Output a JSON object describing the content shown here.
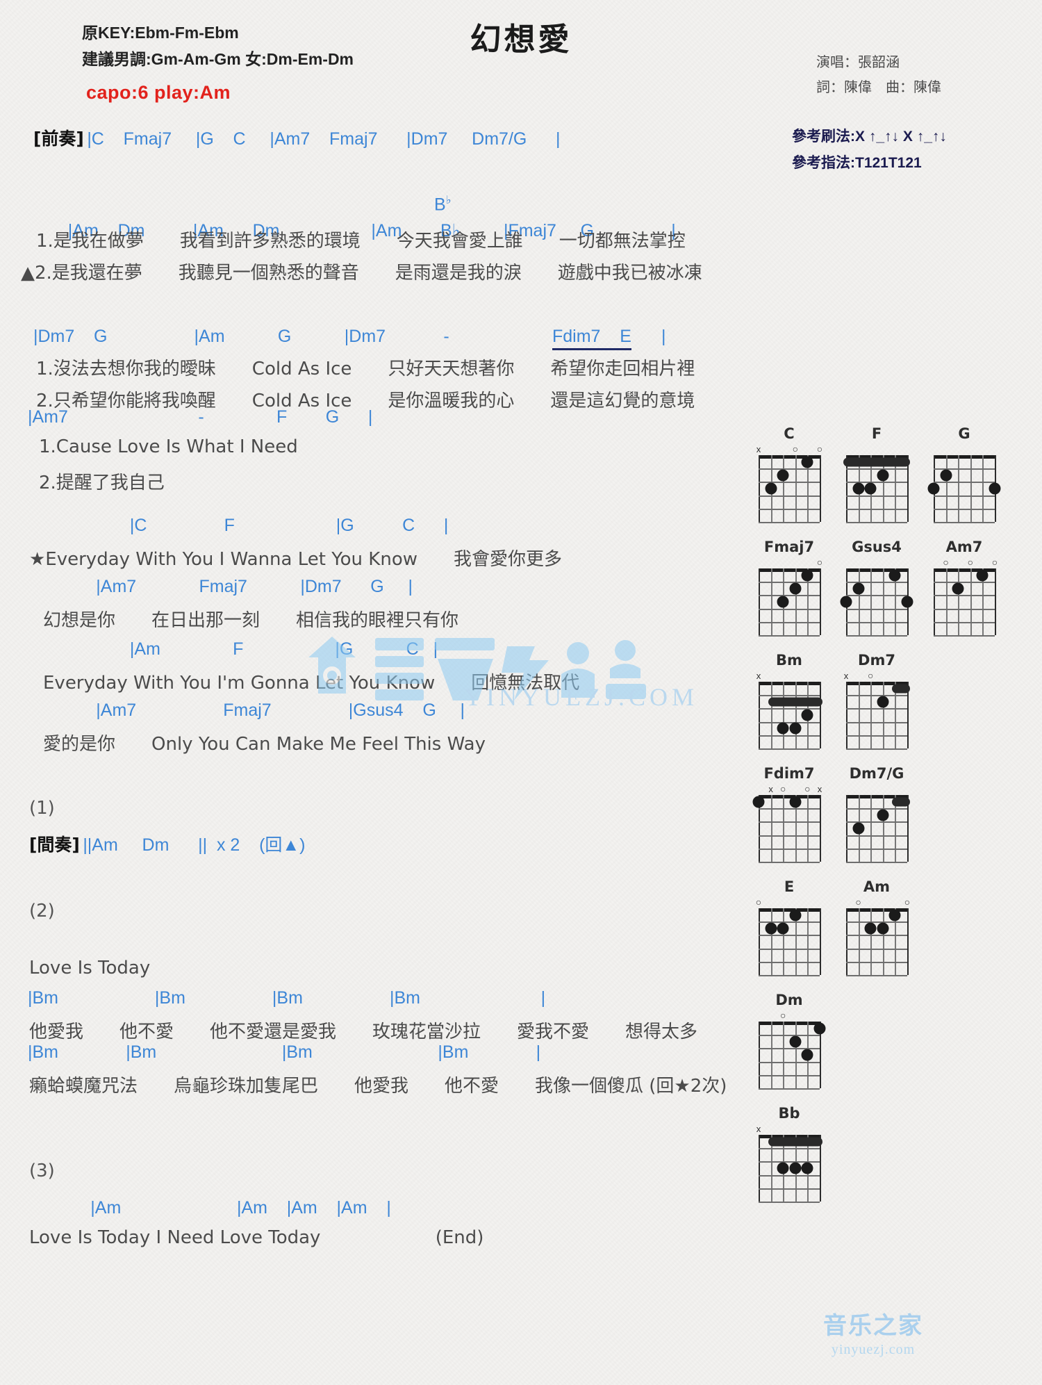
{
  "header": {
    "title": "幻想愛",
    "orig_key": "原KEY:Ebm-Fm-Ebm",
    "suggest_key": "建議男調:Gm-Am-Gm 女:Dm-Em-Dm",
    "capo": "capo:6 play:Am",
    "singer": "演唱：張韶涵",
    "writer": "詞：陳偉　曲：陳偉",
    "strum": "參考刷法:X ↑_↑↓ X ↑_↑↓",
    "finger": "參考指法:T121T121"
  },
  "sections": {
    "intro_tag": "[前奏]",
    "intro_chords": "|C    Fmaj7     |G    C     |Am7    Fmaj7      |Dm7     Dm7/G      |",
    "verse1": {
      "chords1": "|Am    Dm          |Am      Dm                   |Am        B♭         |Fmaj7     G                |",
      "lyric1": "1.是我在做夢　　我看到許多熟悉的環境　　今天我會愛上誰　　一切都無法掌控",
      "lyric2": "▲2.是我還在夢　　我聽見一個熟悉的聲音　　是雨還是我的淚　　遊戲中我已被冰凍",
      "chords2_a": "|Dm7    G                  |Am           G           |Dm7            -   ",
      "chords2_b": "Fdim7    E",
      "chords2_c": "|",
      "lyric3": "1.沒法去想你我的曖昧　　Cold As Ice　　只好天天想著你　　希望你走回相片裡",
      "lyric4": "2.只希望你能將我喚醒　　Cold As Ice　　是你溫暖我的心　　還是這幻覺的意境",
      "chords3": "|Am7                           -               F        G      |",
      "lyric5": "1.Cause Love Is What I Need",
      "lyric6": "2.提醒了我自己"
    },
    "chorus": {
      "chords1": "                    |C                F                     |G          C      |",
      "lyric1": "★Everyday With You I Wanna Let You Know　　我會愛你更多",
      "chords2": "             |Am7             Fmaj7           |Dm7      G     |",
      "lyric2": "幻想是你　　在日出那一刻　　相信我的眼裡只有你",
      "chords3": "                    |Am               F                   |G           C   |",
      "lyric3": "Everyday With You I'm Gonna Let You Know　　回憶無法取代",
      "chords4": "             |Am7                  Fmaj7                |Gsus4    G     |",
      "lyric4": "愛的是你　　Only You Can Make Me Feel This Way"
    },
    "marker1": "(1)",
    "interlude_tag": "[間奏]",
    "interlude_chords": "||Am     Dm      ||  x 2    (回▲)",
    "marker2": "(2)",
    "bridge": {
      "lyric0": "Love Is Today",
      "chords1": "|Bm                    |Bm                  |Bm                  |Bm                         |",
      "lyric1": "他愛我　　他不愛　　他不愛還是愛我　　玫瑰花當沙拉　　愛我不愛　　想得太多",
      "chords2": "|Bm              |Bm                          |Bm                          |Bm              |",
      "lyric2": "癩蛤蟆魔咒法　　烏龜珍珠加隻尾巴　　他愛我　　他不愛　　我像一個傻瓜 (回★2次)"
    },
    "marker3": "(3)",
    "ending": {
      "chords": "             |Am                        |Am    |Am    |Am    |",
      "lyric": "Love Is Today I Need Love Today                    (End)"
    }
  },
  "watermark": {
    "site_text": "YINYUEZJ.COM",
    "foot_big": "音乐之家",
    "foot_small": "yinyuezj.com"
  },
  "chord_diagrams": [
    [
      {
        "name": "C",
        "marks": [
          {
            "t": "x",
            "s": 6
          },
          {
            "t": "o",
            "s": 3
          },
          {
            "t": "o",
            "s": 1
          }
        ],
        "dots": [
          {
            "s": 5,
            "f": 3
          },
          {
            "s": 4,
            "f": 2
          },
          {
            "s": 2,
            "f": 1
          }
        ],
        "barre": null
      },
      {
        "name": "F",
        "marks": [],
        "dots": [
          {
            "s": 3,
            "f": 2
          },
          {
            "s": 4,
            "f": 3
          },
          {
            "s": 5,
            "f": 3
          }
        ],
        "barre": {
          "f": 1,
          "from": 6,
          "to": 1
        }
      },
      {
        "name": "G",
        "marks": [],
        "dots": [
          {
            "s": 6,
            "f": 3
          },
          {
            "s": 5,
            "f": 2
          },
          {
            "s": 1,
            "f": 3
          }
        ],
        "barre": null
      }
    ],
    [
      {
        "name": "Fmaj7",
        "marks": [
          {
            "t": "o",
            "s": 1
          }
        ],
        "dots": [
          {
            "s": 4,
            "f": 3
          },
          {
            "s": 3,
            "f": 2
          },
          {
            "s": 2,
            "f": 1
          }
        ],
        "barre": null
      },
      {
        "name": "Gsus4",
        "marks": [],
        "dots": [
          {
            "s": 6,
            "f": 3
          },
          {
            "s": 5,
            "f": 2
          },
          {
            "s": 2,
            "f": 1
          },
          {
            "s": 1,
            "f": 3
          }
        ],
        "barre": null
      },
      {
        "name": "Am7",
        "marks": [
          {
            "t": "o",
            "s": 5
          },
          {
            "t": "o",
            "s": 3
          },
          {
            "t": "o",
            "s": 1
          }
        ],
        "dots": [
          {
            "s": 4,
            "f": 2
          },
          {
            "s": 2,
            "f": 1
          }
        ],
        "barre": null
      }
    ],
    [
      {
        "name": "Bm",
        "marks": [
          {
            "t": "x",
            "s": 6
          }
        ],
        "dots": [
          {
            "s": 2,
            "f": 3
          },
          {
            "s": 4,
            "f": 4
          },
          {
            "s": 3,
            "f": 4
          }
        ],
        "barre": {
          "f": 2,
          "from": 5,
          "to": 1
        }
      },
      {
        "name": "Dm7",
        "marks": [
          {
            "t": "x",
            "s": 6
          },
          {
            "t": "o",
            "s": 4
          }
        ],
        "dots": [
          {
            "s": 3,
            "f": 2
          }
        ],
        "barre": {
          "f": 1,
          "from": 2,
          "to": 1
        }
      }
    ],
    [
      {
        "name": "Fdim7",
        "marks": [
          {
            "t": "x",
            "s": 5
          },
          {
            "t": "o",
            "s": 4
          },
          {
            "t": "o",
            "s": 2
          },
          {
            "t": "x",
            "s": 1
          }
        ],
        "dots": [
          {
            "s": 6,
            "f": 1
          },
          {
            "s": 3,
            "f": 1
          }
        ],
        "barre": null
      },
      {
        "name": "Dm7/G",
        "marks": [],
        "dots": [
          {
            "s": 5,
            "f": 3
          },
          {
            "s": 3,
            "f": 2
          }
        ],
        "barre": {
          "f": 1,
          "from": 2,
          "to": 1
        }
      }
    ],
    [
      {
        "name": "E",
        "marks": [
          {
            "t": "o",
            "s": 6
          }
        ],
        "dots": [
          {
            "s": 5,
            "f": 2
          },
          {
            "s": 4,
            "f": 2
          },
          {
            "s": 3,
            "f": 1
          }
        ],
        "barre": null
      },
      {
        "name": "Am",
        "marks": [
          {
            "t": "o",
            "s": 5
          },
          {
            "t": "o",
            "s": 1
          }
        ],
        "dots": [
          {
            "s": 4,
            "f": 2
          },
          {
            "s": 3,
            "f": 2
          },
          {
            "s": 2,
            "f": 1
          }
        ],
        "barre": null
      }
    ],
    [
      {
        "name": "Dm",
        "marks": [
          {
            "t": "o",
            "s": 4
          }
        ],
        "dots": [
          {
            "s": 3,
            "f": 2
          },
          {
            "s": 2,
            "f": 3
          },
          {
            "s": 1,
            "f": 1
          }
        ],
        "barre": null
      }
    ],
    [
      {
        "name": "Bb",
        "marks": [
          {
            "t": "x",
            "s": 6
          }
        ],
        "dots": [
          {
            "s": 2,
            "f": 3
          },
          {
            "s": 3,
            "f": 3
          },
          {
            "s": 4,
            "f": 3
          }
        ],
        "barre": {
          "f": 1,
          "from": 5,
          "to": 1
        }
      }
    ]
  ],
  "colors": {
    "chord_blue": "#3d86d6",
    "bar_navy": "#1f2a66",
    "capo_red": "#e2221c",
    "watermark_blue": "#9ecbee"
  }
}
